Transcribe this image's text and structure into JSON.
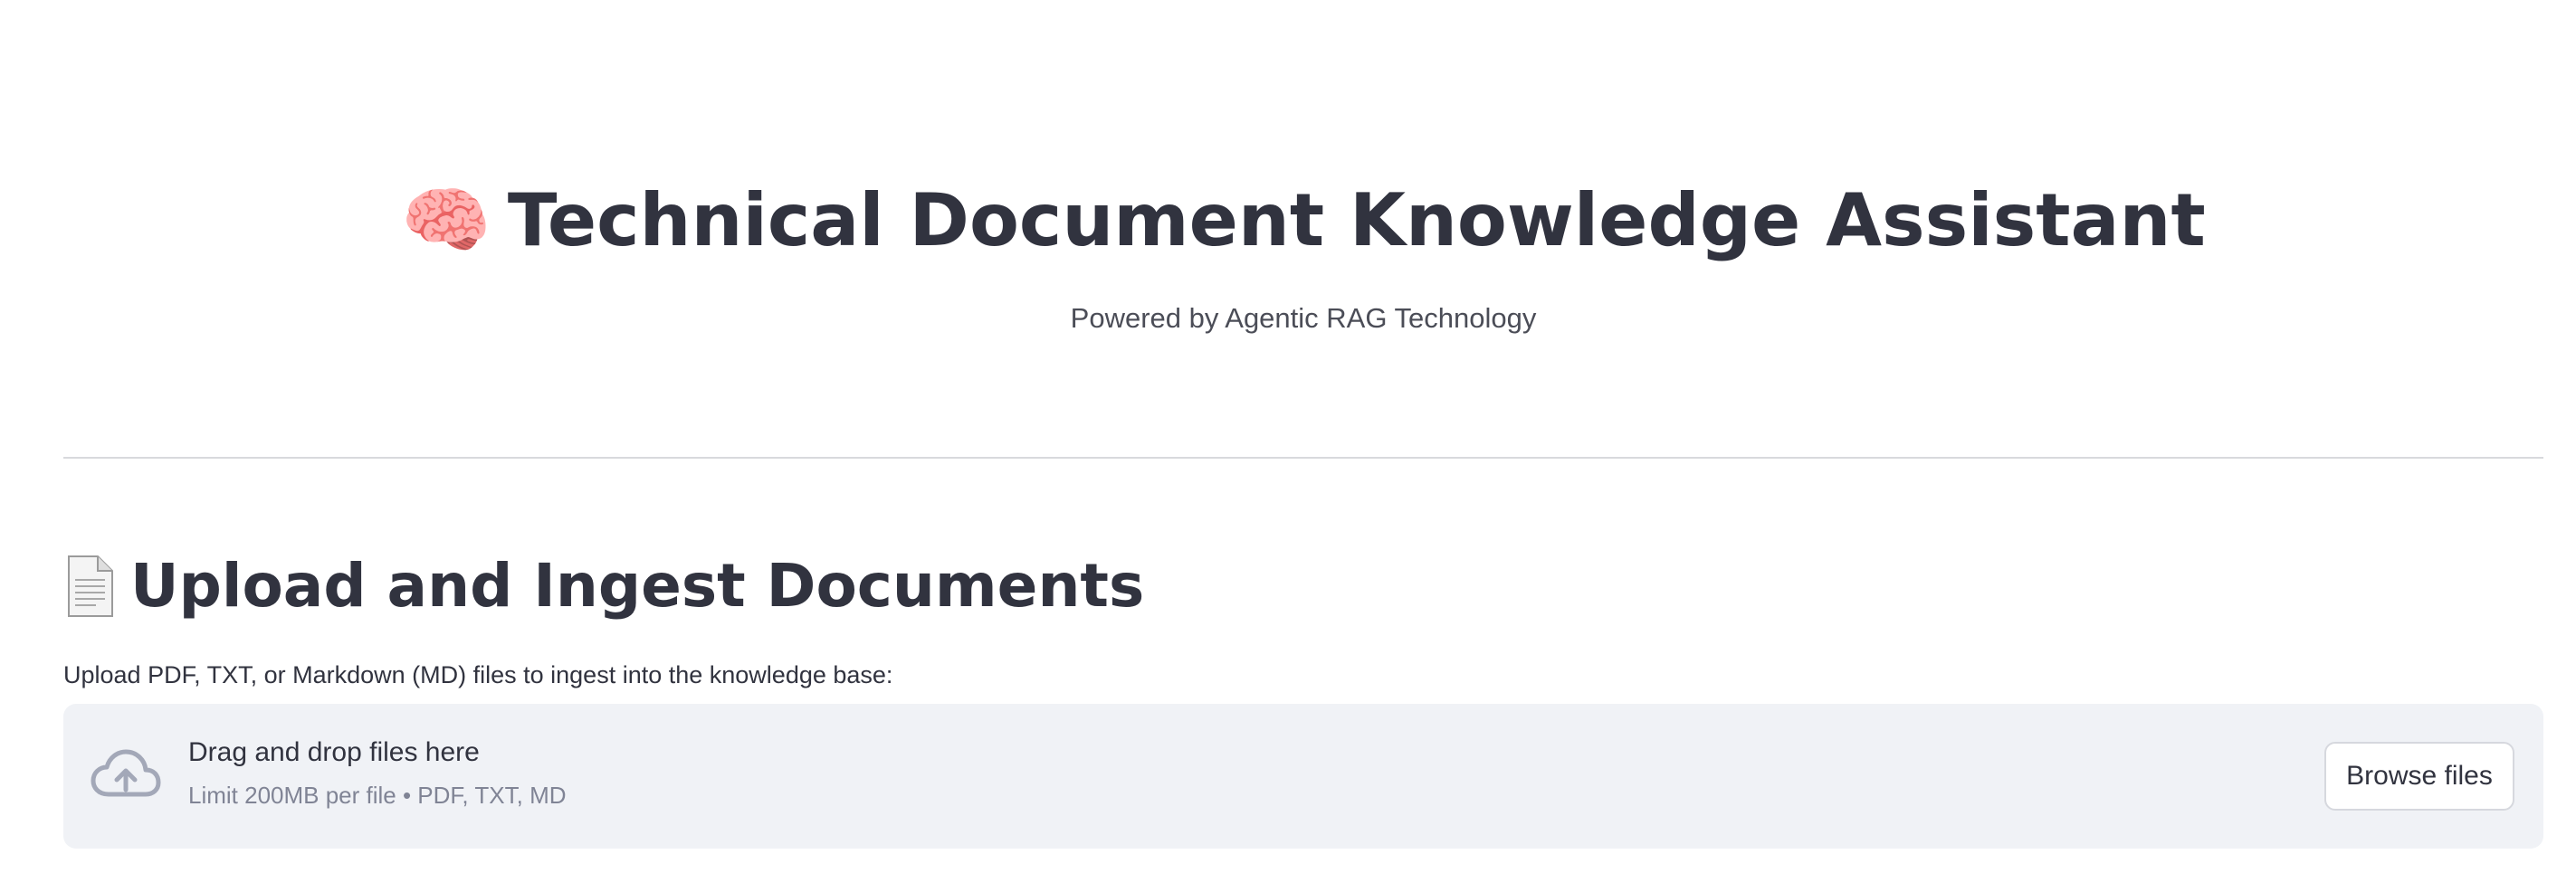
{
  "header": {
    "emoji": "🧠",
    "title": "Technical Document Knowledge Assistant",
    "subtitle": "Powered by Agentic RAG Technology"
  },
  "upload_section": {
    "icon": "page-facing-up-icon",
    "title": "Upload and Ingest Documents",
    "instruction": "Upload PDF, TXT, or Markdown (MD) files to ingest into the knowledge base:",
    "dropzone": {
      "icon": "cloud-upload-icon",
      "title": "Drag and drop files here",
      "limit": "Limit 200MB per file • PDF, TXT, MD",
      "button_label": "Browse files"
    }
  },
  "colors": {
    "text": "#31333f",
    "muted": "#808495",
    "dropzone_bg": "#f0f2f6",
    "icon": "#a3a8b8"
  }
}
